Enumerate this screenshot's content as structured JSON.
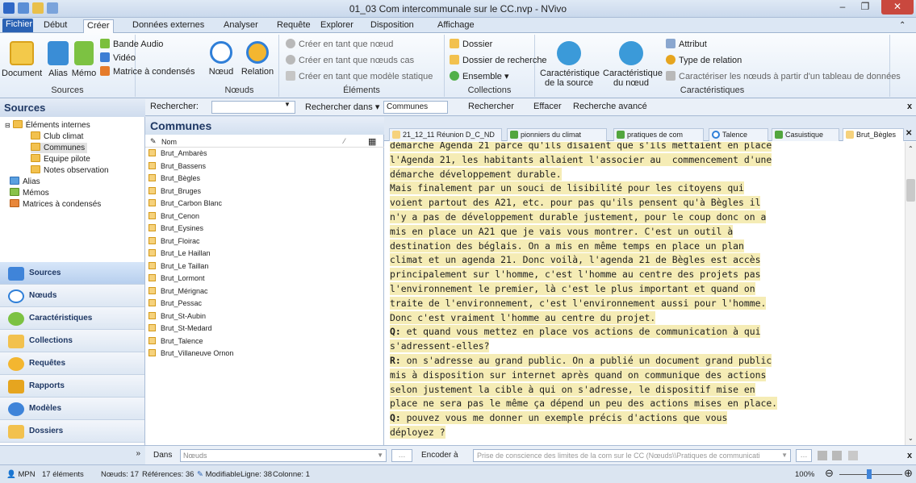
{
  "window": {
    "title": "01_03 Com intercommunale sur le CC.nvp - NVivo"
  },
  "tabs": [
    "Fichier",
    "Début",
    "Créer",
    "Données externes",
    "Analyser",
    "Requête",
    "Explorer",
    "Disposition",
    "Affichage"
  ],
  "ribbon": {
    "sources": {
      "document": "Document",
      "alias": "Alias",
      "memo": "Mémo",
      "audio": "Bande Audio",
      "video": "Vidéo",
      "matrix": "Matrice à condensés",
      "label": "Sources"
    },
    "nodes": {
      "node": "Nœud",
      "relation": "Relation",
      "label": "Nœuds"
    },
    "elements": {
      "item1": "Créer en tant que nœud",
      "item2": "Créer en tant que nœuds cas",
      "item3": "Créer en tant que modèle statique",
      "label": "Éléments"
    },
    "collections": {
      "folder": "Dossier",
      "search_folder": "Dossier de recherche",
      "set": "Ensemble ▾",
      "label": "Collections"
    },
    "attributes": {
      "source_attr": "Caractéristique de la source",
      "node_attr": "Caractéristique du nœud",
      "attribute": "Attribut",
      "relation_type": "Type de relation",
      "classify": "Caractériser les nœuds à partir d'un tableau de données",
      "label": "Caractéristiques"
    }
  },
  "searchbar": {
    "pane_title": "Sources",
    "label": "Rechercher:",
    "search_in": "Rechercher dans",
    "scope": "Communes",
    "find": "Rechercher",
    "clear": "Effacer",
    "advanced": "Recherche avancé",
    "close": "x"
  },
  "tree": {
    "root": "Éléments internes",
    "children": [
      "Club climat",
      "Communes",
      "Equipe pilote",
      "Notes observation"
    ],
    "others": [
      "Alias",
      "Mémos",
      "Matrices à condensés"
    ]
  },
  "nav": [
    "Sources",
    "Nœuds",
    "Caractéristiques",
    "Collections",
    "Requêtes",
    "Rapports",
    "Modèles",
    "Dossiers"
  ],
  "list": {
    "title": "Communes",
    "header": "Nom",
    "items": [
      "Brut_Ambarès",
      "Brut_Bassens",
      "Brut_Bègles",
      "Brut_Bruges",
      "Brut_Carbon Blanc",
      "Brut_Cenon",
      "Brut_Eysines",
      "Brut_Floirac",
      "Brut_Le Haillan",
      "Brut_Le Taillan",
      "Brut_Lormont",
      "Brut_Mérignac",
      "Brut_Pessac",
      "Brut_St-Aubin",
      "Brut_St-Medard",
      "Brut_Talence",
      "Brut_Villaneuve Ornon"
    ]
  },
  "doc_tabs": [
    "21_12_11 Réunion D_C_ND",
    "pionniers du climat",
    "pratiques de com",
    "Talence",
    "Casuistique",
    "Brut_Bègles"
  ],
  "doc_lines": [
    "démarche Agenda 21 parce qu'ils disaient que s'ils mettaient en place",
    "l'Agenda 21, les habitants allaient l'associer au  commencement d'une",
    "démarche développement durable.",
    "Mais finalement par un souci de lisibilité pour les citoyens qui",
    "voient partout des A21, etc. pour pas qu'ils pensent qu'à Bègles il",
    "n'y a pas de développement durable justement, pour le coup donc on a",
    "mis en place un A21 que je vais vous montrer. C'est un outil à",
    "destination des béglais. On a mis en même temps en place un plan",
    "climat et un agenda 21. Donc voilà, l'agenda 21 de Bègles est accès",
    "principalement sur l'homme, c'est l'homme au centre des projets pas",
    "l'environnement le premier, là c'est le plus important et quand on",
    "traite de l'environnement, c'est l'environnement aussi pour l'homme.",
    "Donc c'est vraiment l'homme au centre du projet.",
    "Q: et quand vous mettez en place vos actions de communication à qui",
    "s'adressent-elles?",
    "R: on s'adresse au grand public. On a publié un document grand public",
    "mis à disposition sur internet après quand on communique des actions",
    "selon justement la cible à qui on s'adresse, le dispositif mise en",
    "place ne sera pas le même ça dépend un peu des actions mises en place.",
    "Q: pouvez vous me donner un exemple précis d'actions que vous",
    "déployez ?"
  ],
  "codebar": {
    "in_label": "Dans",
    "in_value": "Nœuds",
    "code_label": "Encoder à",
    "code_value": "Prise de conscience des limites de la com sur le CC (Nœuds\\\\Pratiques de communicati",
    "close": "x"
  },
  "status": {
    "user": "MPN",
    "items": "17 éléments",
    "nodes": "Nœuds: 17",
    "refs": "Références: 36",
    "editable": "Modifiable",
    "line": "Ligne: 38",
    "col": "Colonne: 1",
    "zoom": "100%"
  },
  "colors": {
    "accent": "#2a62b4",
    "highlight": "#f5ecb5",
    "header_text": "#1f3864"
  }
}
